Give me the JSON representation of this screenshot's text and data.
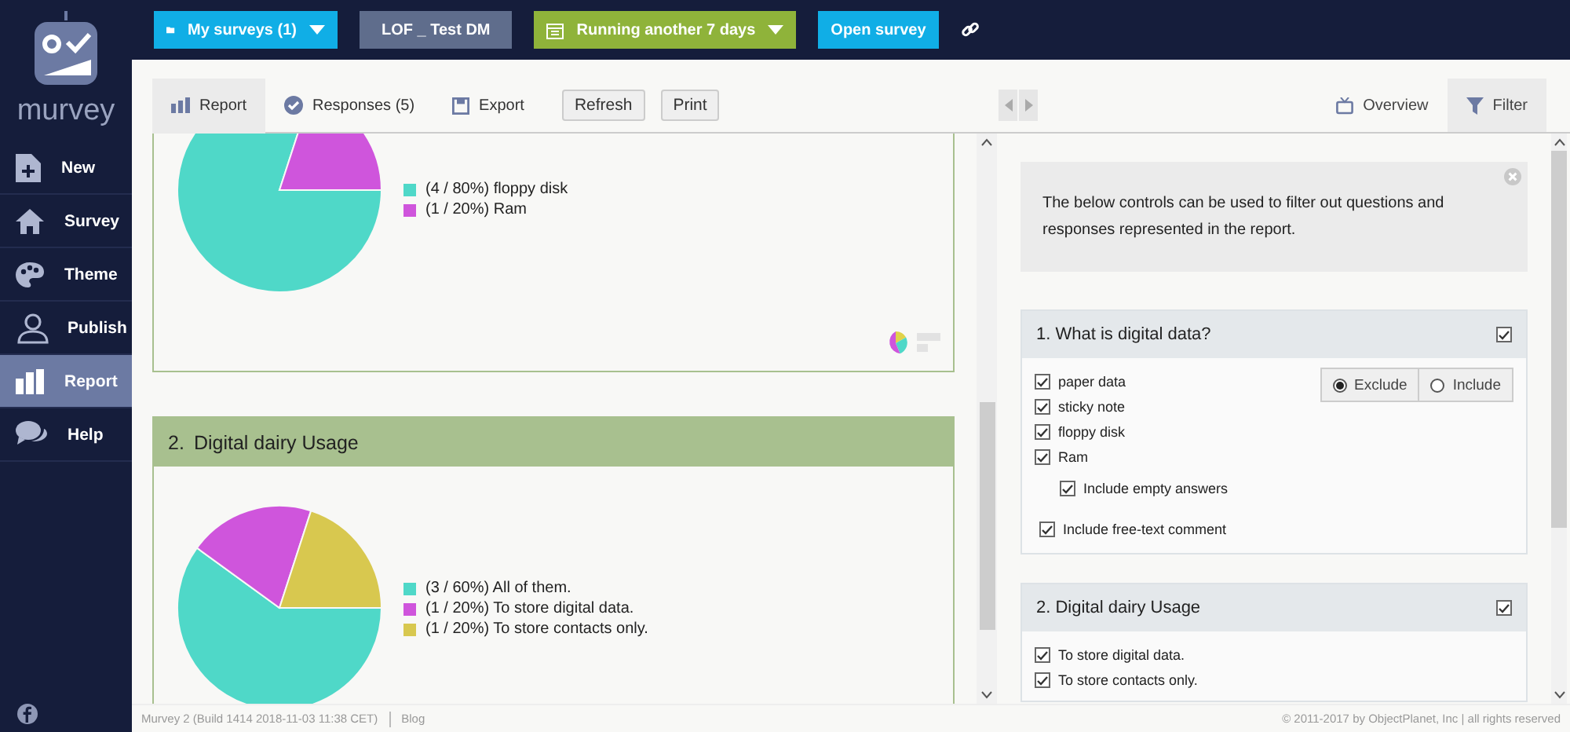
{
  "app": {
    "logo_text": "murvey"
  },
  "sidebar": {
    "items": [
      {
        "label": "New",
        "selected": false
      },
      {
        "label": "Survey",
        "selected": false
      },
      {
        "label": "Theme",
        "selected": false
      },
      {
        "label": "Publish",
        "selected": false
      },
      {
        "label": "Report",
        "selected": true
      },
      {
        "label": "Help",
        "selected": false
      }
    ]
  },
  "topbar": {
    "surveys_menu": "My surveys (1)",
    "survey_name": "LOF _ Test DM",
    "status_menu": "Running another 7 days",
    "open_button": "Open survey"
  },
  "report_tabs": [
    {
      "label": "Report",
      "selected": true
    },
    {
      "label": "Responses (5)",
      "selected": false
    },
    {
      "label": "Export",
      "selected": false
    }
  ],
  "report_buttons": [
    "Refresh",
    "Print"
  ],
  "questions": [
    {
      "legend": [
        {
          "color": "#4fd8c8"
        },
        {
          "color": "#cf55dc"
        }
      ],
      "chart_data": {
        "type": "pie",
        "categories": [
          "(4 / 80%) floppy disk",
          "(1 / 20%) Ram"
        ],
        "values": [
          4,
          1
        ]
      }
    },
    {
      "number": "2.",
      "title": "Digital dairy Usage",
      "legend": [
        {
          "color": "#4fd8c8"
        },
        {
          "color": "#cf55dc"
        },
        {
          "color": "#d8c84f"
        }
      ],
      "chart_data": {
        "type": "pie",
        "categories": [
          "(3 / 60%) All of them.",
          "(1 / 20%) To store digital data.",
          "(1 / 20%) To store contacts only."
        ],
        "values": [
          3,
          1,
          1
        ]
      }
    }
  ],
  "panel_tabs": [
    {
      "label": "Overview",
      "selected": false
    },
    {
      "label": "Filter",
      "selected": true
    }
  ],
  "filter": {
    "info": "The below controls can be used to filter out questions and responses represented in the report.",
    "groups": [
      {
        "title": "1. What is digital data?",
        "checked": true,
        "options": [
          {
            "label": "paper data",
            "checked": true
          },
          {
            "label": "sticky note",
            "checked": true
          },
          {
            "label": "floppy disk",
            "checked": true
          },
          {
            "label": "Ram",
            "checked": true
          }
        ],
        "modes": [
          {
            "label": "Exclude",
            "selected": true
          },
          {
            "label": "Include",
            "selected": false
          }
        ],
        "extras": [
          {
            "label": "Include empty answers",
            "checked": true,
            "kind": "nested"
          },
          {
            "label": "Include free-text comment",
            "checked": true,
            "kind": "plain"
          }
        ]
      },
      {
        "title": "2. Digital dairy Usage",
        "checked": true,
        "options": [
          {
            "label": "To store digital data.",
            "checked": true
          },
          {
            "label": "To store contacts only.",
            "checked": true
          }
        ]
      }
    ]
  },
  "footer": {
    "build": "Murvey 2 (Build 1414 2018-11-03 11:38 CET)",
    "link": "Blog",
    "copyright": "© 2011-2017 by ObjectPlanet, Inc | all rights reserved"
  }
}
